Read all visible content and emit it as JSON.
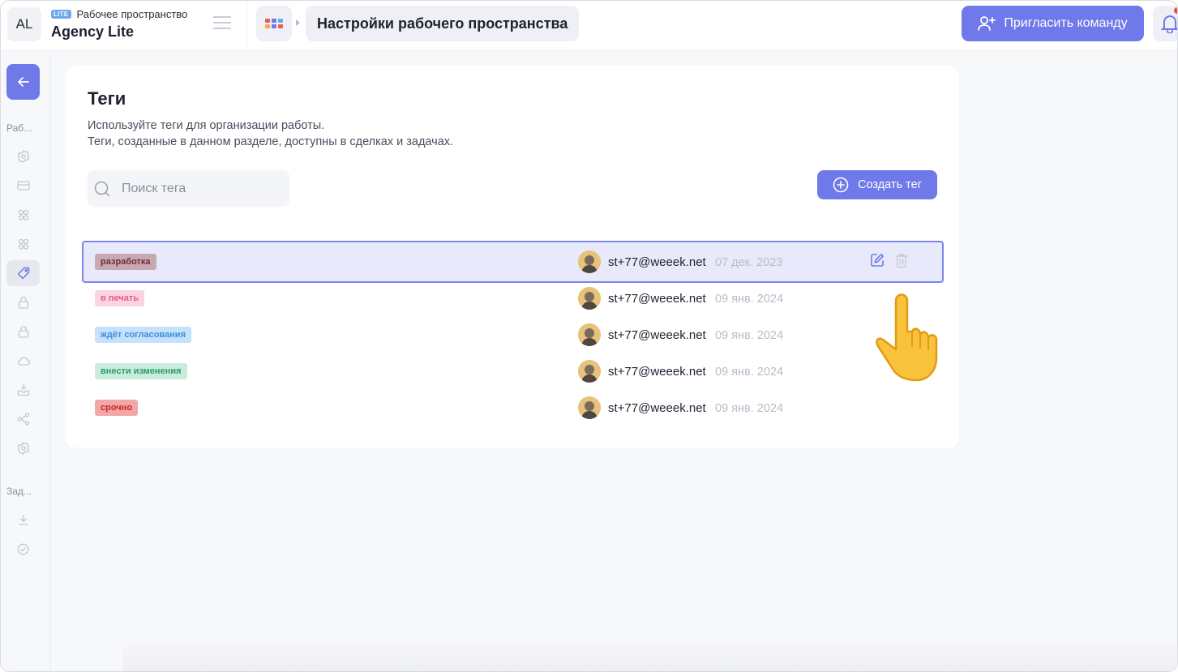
{
  "workspace": {
    "avatar_initials": "AL",
    "badge": "LITE",
    "kind_label": "Рабочее пространство",
    "name": "Agency Lite"
  },
  "breadcrumb": {
    "page_title": "Настройки рабочего пространства"
  },
  "header": {
    "invite_label": "Пригласить команду",
    "invite_icon": "user-plus-icon",
    "notification_icon": "bell-icon"
  },
  "sidebar": {
    "section1_label": "Раб...",
    "section2_label": "Зад...",
    "section1_icons": [
      "gear-icon",
      "card-icon",
      "users-icon",
      "users-alt-icon",
      "tag-icon",
      "lock-icon",
      "lock-alt-icon",
      "cloud-icon",
      "inbox-icon",
      "share-icon",
      "settings-icon"
    ],
    "section2_icons": [
      "download-icon",
      "check-circle-icon"
    ],
    "active_item": "tag-icon"
  },
  "main": {
    "title": "Теги",
    "description_line1": "Используйте теги для организации работы.",
    "description_line2": "Теги, созданные в данном разделе, доступны в сделках и задачах.",
    "search_placeholder": "Поиск тега",
    "create_label": "Создать тег",
    "tags": [
      {
        "name": "разработка",
        "author": "st+77@weeek.net",
        "date": "07 дек. 2023",
        "bg": "#c8a8b2",
        "fg": "#6e2c3d",
        "selected": true
      },
      {
        "name": "в печать",
        "author": "st+77@weeek.net",
        "date": "09 янв. 2024",
        "bg": "#fbd3e1",
        "fg": "#e85a8e",
        "selected": false
      },
      {
        "name": "ждёт согласования",
        "author": "st+77@weeek.net",
        "date": "09 янв. 2024",
        "bg": "#c6e1fb",
        "fg": "#3b8ddc",
        "selected": false
      },
      {
        "name": "внести изменения",
        "author": "st+77@weeek.net",
        "date": "09 янв. 2024",
        "bg": "#c9ecdd",
        "fg": "#2f9a6c",
        "selected": false
      },
      {
        "name": "срочно",
        "author": "st+77@weeek.net",
        "date": "09 янв. 2024",
        "bg": "#f3a7a7",
        "fg": "#c72525",
        "selected": false
      }
    ]
  },
  "colors": {
    "accent": "#6f79ea",
    "selected_row_bg": "#e8eafb",
    "selected_row_border": "#7c85ec"
  }
}
